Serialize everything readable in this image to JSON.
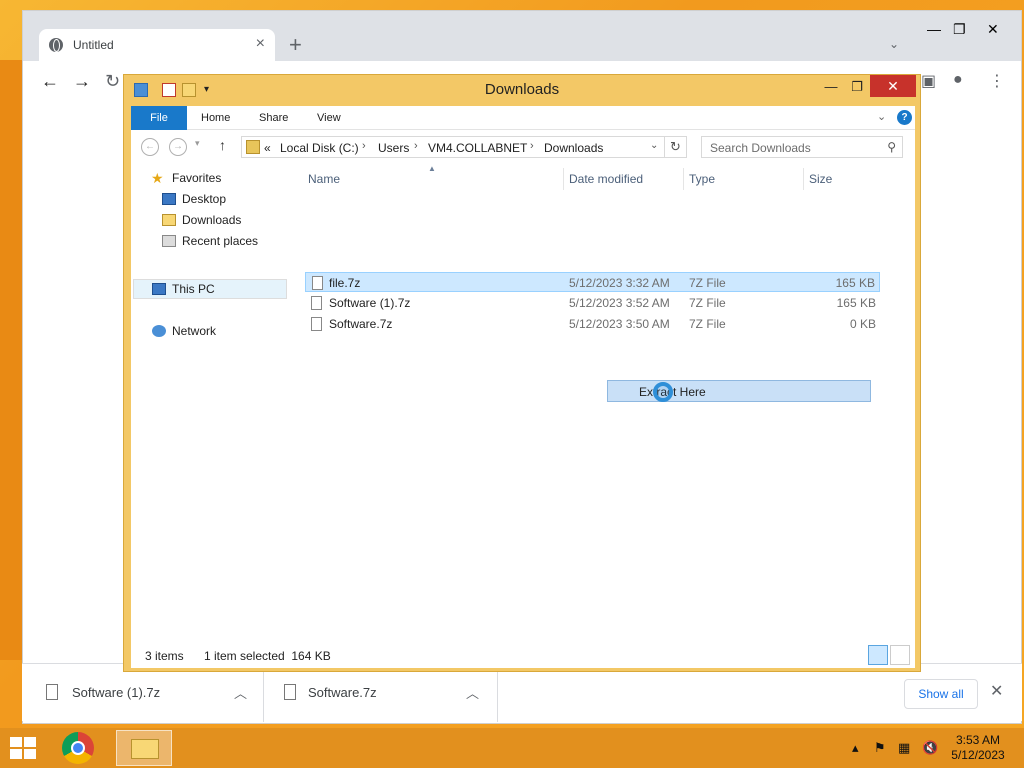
{
  "browser": {
    "tab_title": "Untitled",
    "new_tab_glyph": "+",
    "icons": [
      "globe-icon",
      "close-icon",
      "back-icon",
      "forward-icon",
      "reload-icon",
      "profile-icon",
      "menu-icon"
    ]
  },
  "explorer": {
    "title": "Downloads",
    "ribbon_tabs": [
      "File",
      "Home",
      "Share",
      "View"
    ],
    "address": {
      "prefix": "«",
      "crumbs": [
        "Local Disk (C:)",
        "Users",
        "VM4.COLLABNET",
        "Downloads"
      ]
    },
    "search_placeholder": "Search Downloads",
    "nav": {
      "favorites": "Favorites",
      "favorites_items": [
        "Desktop",
        "Downloads",
        "Recent places"
      ],
      "this_pc": "This PC",
      "network": "Network"
    },
    "columns": [
      "Name",
      "Date modified",
      "Type",
      "Size"
    ],
    "files": [
      {
        "name": "file.7z",
        "date": "5/12/2023 3:32 AM",
        "type": "7Z File",
        "size": "165 KB",
        "selected": true
      },
      {
        "name": "Software (1).7z",
        "date": "5/12/2023 3:52 AM",
        "type": "7Z File",
        "size": "165 KB",
        "selected": false
      },
      {
        "name": "Software.7z",
        "date": "5/12/2023 3:50 AM",
        "type": "7Z File",
        "size": "0 KB",
        "selected": false
      }
    ],
    "context_menu_item": "Extract Here",
    "status": {
      "items": "3 items",
      "selection": "1 item selected  164 KB"
    }
  },
  "downloads_bar": {
    "items": [
      "Software (1).7z",
      "Software.7z"
    ],
    "show_all": "Show all"
  },
  "taskbar": {
    "time": "3:53 AM",
    "date": "5/12/2023"
  }
}
